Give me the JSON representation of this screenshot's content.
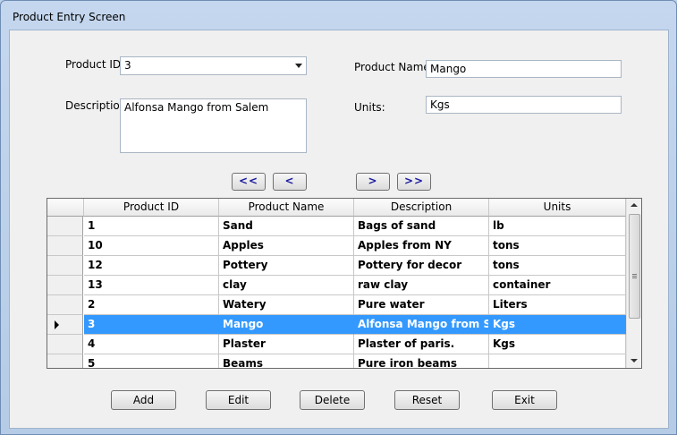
{
  "window": {
    "title": "Product Entry Screen"
  },
  "form": {
    "product_id_label": "Product ID:",
    "product_id_value": "3",
    "product_name_label": "Product Name:",
    "product_name_value": "Mango",
    "description_label": "Description:",
    "description_value": "Alfonsa Mango from Salem",
    "units_label": "Units:",
    "units_value": "Kgs"
  },
  "nav": {
    "first": "<<",
    "prev": "<",
    "next": ">",
    "last": ">>"
  },
  "grid": {
    "columns": [
      "Product ID",
      "Product Name",
      "Description",
      "Units"
    ],
    "rows": [
      [
        "1",
        "Sand",
        "Bags of sand",
        "lb"
      ],
      [
        "10",
        "Apples",
        "Apples from NY",
        "tons"
      ],
      [
        "12",
        "Pottery",
        "Pottery for decor",
        "tons"
      ],
      [
        "13",
        "clay",
        "raw clay",
        "container"
      ],
      [
        "2",
        "Watery",
        "Pure water",
        "Liters"
      ],
      [
        "3",
        "Mango",
        "Alfonsa Mango from Sa...",
        "Kgs"
      ],
      [
        "4",
        "Plaster",
        "Plaster of paris.",
        "Kgs"
      ],
      [
        "5",
        "Beams",
        "Pure iron beams",
        ""
      ]
    ],
    "selected_row": 5,
    "selection_color": "#3399ff"
  },
  "actions": {
    "add": "Add",
    "edit": "Edit",
    "delete": "Delete",
    "reset": "Reset",
    "exit": "Exit"
  }
}
